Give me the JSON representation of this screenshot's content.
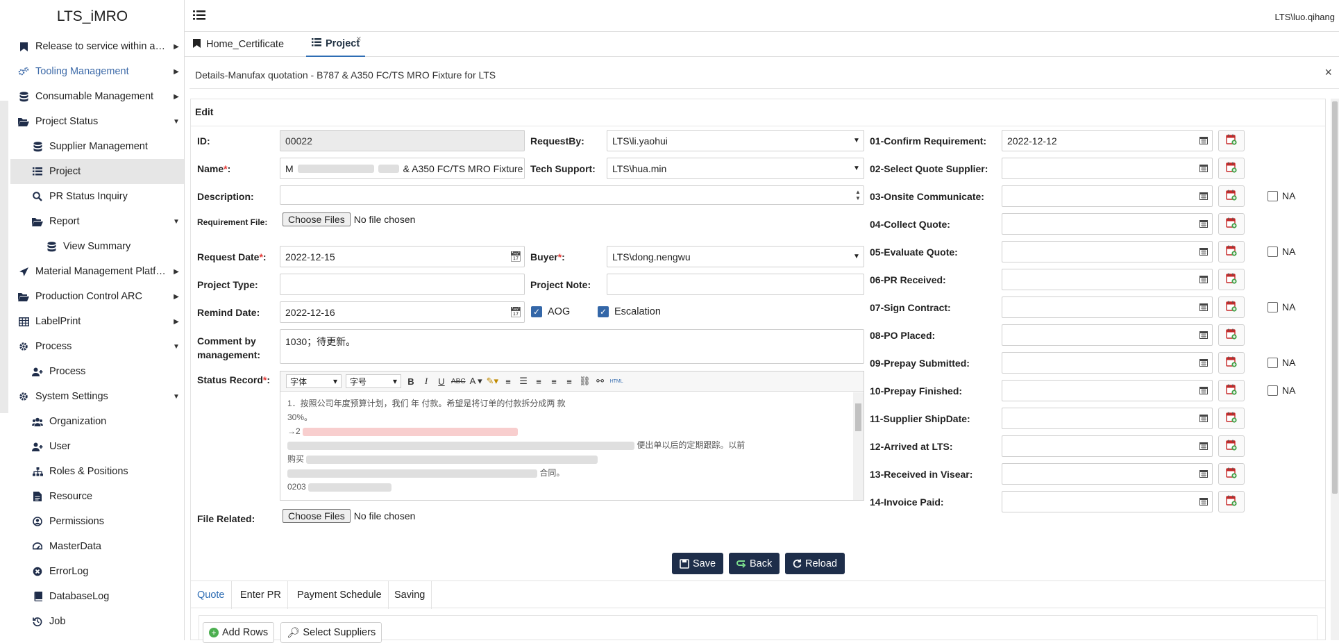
{
  "app": {
    "title": "LTS_iMRO",
    "user": "LTS\\luo.qihang"
  },
  "sidebar": {
    "items": [
      {
        "label": "Release to service within aut...",
        "icon": "bookmark-icon",
        "caret": "right"
      },
      {
        "label": "Tooling Management",
        "icon": "gears-icon",
        "caret": "right"
      },
      {
        "label": "Consumable Management",
        "icon": "database-icon",
        "caret": "right"
      },
      {
        "label": "Project Status",
        "icon": "folder-open-icon",
        "caret": "down"
      },
      {
        "label": "Supplier Management",
        "icon": "database-icon"
      },
      {
        "label": "Project",
        "icon": "list-icon"
      },
      {
        "label": "PR Status Inquiry",
        "icon": "search-icon"
      },
      {
        "label": "Report",
        "icon": "folder-open-icon",
        "caret": "down"
      },
      {
        "label": "View Summary",
        "icon": "database-icon"
      },
      {
        "label": "Material Management Platform",
        "icon": "plane-icon",
        "caret": "right"
      },
      {
        "label": "Production Control ARC",
        "icon": "folder-open-icon",
        "caret": "right"
      },
      {
        "label": "LabelPrint",
        "icon": "table-icon",
        "caret": "right"
      },
      {
        "label": "Process",
        "icon": "gear-icon",
        "caret": "down"
      },
      {
        "label": "Process",
        "icon": "user-plus-icon"
      },
      {
        "label": "System Settings",
        "icon": "gear-icon",
        "caret": "down"
      },
      {
        "label": "Organization",
        "icon": "users-icon"
      },
      {
        "label": "User",
        "icon": "user-plus-icon"
      },
      {
        "label": "Roles & Positions",
        "icon": "sitemap-icon"
      },
      {
        "label": "Resource",
        "icon": "file-icon"
      },
      {
        "label": "Permissions",
        "icon": "user-circle-icon"
      },
      {
        "label": "MasterData",
        "icon": "dashboard-icon"
      },
      {
        "label": "ErrorLog",
        "icon": "error-circle-icon"
      },
      {
        "label": "DatabaseLog",
        "icon": "book-icon"
      },
      {
        "label": "Job",
        "icon": "history-icon"
      }
    ]
  },
  "tabs": [
    {
      "label": "Home_Certificate",
      "icon": "bookmark-icon"
    },
    {
      "label": "Project",
      "icon": "list-icon",
      "close": "×"
    }
  ],
  "detail": {
    "title": "Details-Manufax quotation - B787 & A350 FC/TS MRO Fixture for LTS",
    "close": "×",
    "edit_heading": "Edit"
  },
  "form": {
    "id": {
      "label": "ID:",
      "value": "00022"
    },
    "name": {
      "label": "Name",
      "suffix": ":",
      "value": "& A350 FC/TS MRO Fixture",
      "prefix": "M"
    },
    "description": {
      "label": "Description:",
      "value": ""
    },
    "requirement_file": {
      "label": "Requirement File:",
      "button": "Choose Files",
      "status": "No file chosen"
    },
    "request_date": {
      "label": "Request Date",
      "suffix": ":",
      "value": "2022-12-15"
    },
    "project_type": {
      "label": "Project Type:",
      "value": ""
    },
    "remind_date": {
      "label": "Remind Date:",
      "value": "2022-12-16"
    },
    "comment": {
      "label": "Comment by management:",
      "value": "1030；待更新。"
    },
    "status_record": {
      "label": "Status Record",
      "suffix": ":"
    },
    "file_related": {
      "label": "File Related:",
      "button": "Choose Files",
      "status": "No file chosen"
    },
    "request_by": {
      "label": "RequestBy:",
      "value": "LTS\\li.yaohui"
    },
    "tech_support": {
      "label": "Tech Support:",
      "value": "LTS\\hua.min"
    },
    "buyer": {
      "label": "Buyer",
      "suffix": ":",
      "value": "LTS\\dong.nengwu"
    },
    "project_note": {
      "label": "Project Note:",
      "value": ""
    },
    "aog": {
      "label": "AOG",
      "checked": true
    },
    "escalation": {
      "label": "Escalation",
      "checked": true
    },
    "required_mark": "*"
  },
  "editor": {
    "font_select": "字体",
    "size_select": "字号",
    "lines": [
      "1．按照公司年度预算计划，我们 年 付款。希望是将订单的付款拆分成两 款",
      "30%。",
      "→2",
      "便出单以后的定期跟踪。以前",
      "购买",
      "合同。",
      "0203"
    ]
  },
  "milestones": [
    {
      "label": "01-Confirm Requirement:",
      "value": "2022-12-12",
      "na": false
    },
    {
      "label": "02-Select Quote Supplier:",
      "value": "",
      "na": false
    },
    {
      "label": "03-Onsite Communicate:",
      "value": "",
      "na": true
    },
    {
      "label": "04-Collect Quote:",
      "value": "",
      "na": false
    },
    {
      "label": "05-Evaluate Quote:",
      "value": "",
      "na": true
    },
    {
      "label": "06-PR Received:",
      "value": "",
      "na": false
    },
    {
      "label": "07-Sign Contract:",
      "value": "",
      "na": true
    },
    {
      "label": "08-PO Placed:",
      "value": "",
      "na": false
    },
    {
      "label": "09-Prepay Submitted:",
      "value": "",
      "na": true
    },
    {
      "label": "10-Prepay Finished:",
      "value": "",
      "na": true
    },
    {
      "label": "11-Supplier ShipDate:",
      "value": "",
      "na": false
    },
    {
      "label": "12-Arrived at LTS:",
      "value": "",
      "na": false
    },
    {
      "label": "13-Received in Visear:",
      "value": "",
      "na": false
    },
    {
      "label": "14-Invoice Paid:",
      "value": "",
      "na": false
    }
  ],
  "na_label": "NA",
  "actions": {
    "save": "Save",
    "back": "Back",
    "reload": "Reload"
  },
  "bottom_tabs": [
    "Quote",
    "Enter PR",
    "Payment Schedule",
    "Saving"
  ],
  "quote_actions": {
    "add_rows": "Add Rows",
    "select_suppliers": "Select Suppliers"
  },
  "colors": {
    "accent": "#2e6db4",
    "button_dark": "#1e2e4a",
    "required": "#e53935",
    "checkbox": "#3467a8"
  }
}
